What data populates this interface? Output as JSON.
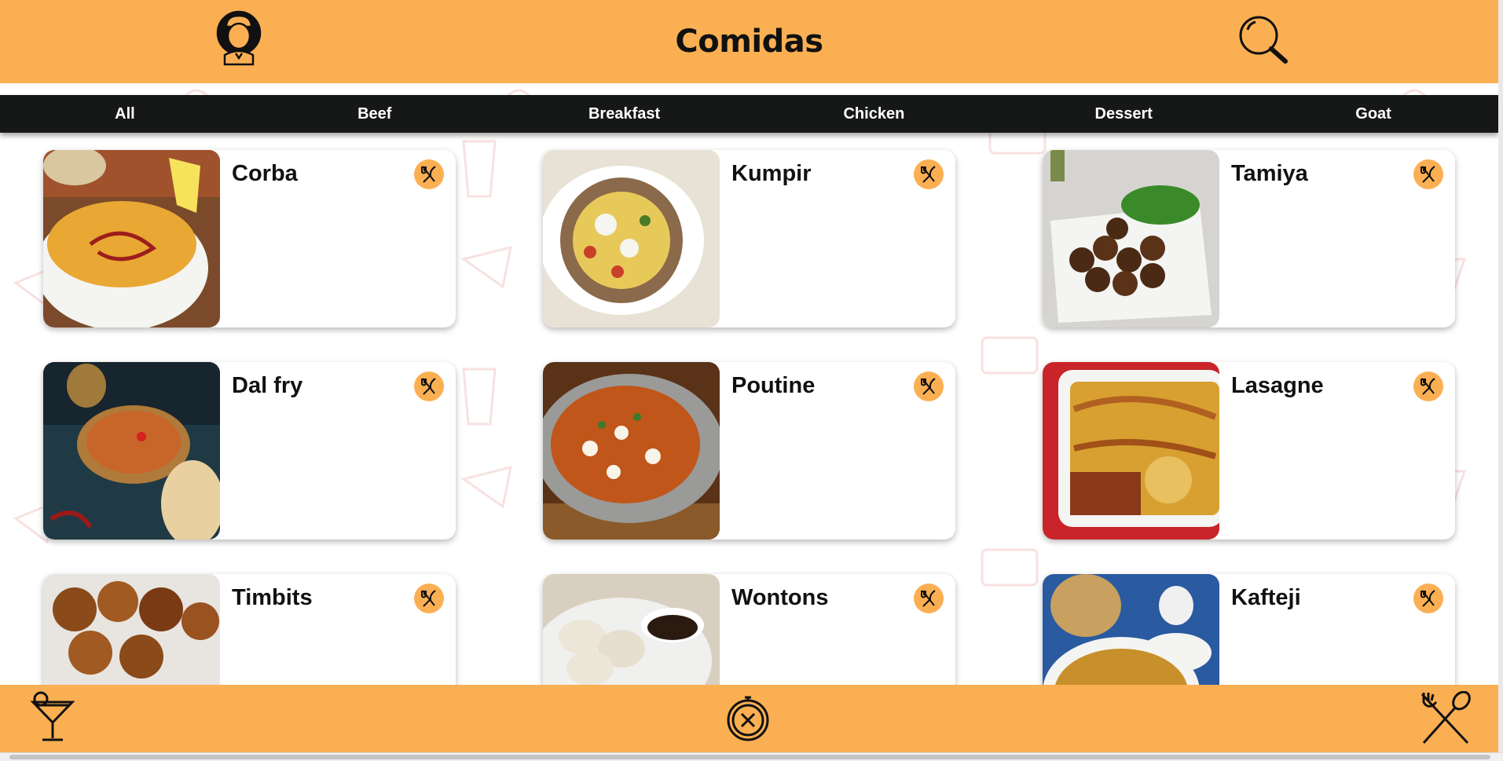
{
  "header": {
    "title": "Comidas",
    "profile_icon": "chef-avatar-icon",
    "search_icon": "search-icon"
  },
  "categories": [
    "All",
    "Beef",
    "Breakfast",
    "Chicken",
    "Dessert",
    "Goat"
  ],
  "recipes": [
    {
      "name": "Corba"
    },
    {
      "name": "Kumpir"
    },
    {
      "name": "Tamiya"
    },
    {
      "name": "Dal fry"
    },
    {
      "name": "Poutine"
    },
    {
      "name": "Lasagne"
    },
    {
      "name": "Timbits"
    },
    {
      "name": "Wontons"
    },
    {
      "name": "Kafteji"
    }
  ],
  "footer": {
    "drinks_icon": "cocktail-icon",
    "explore_icon": "compass-icon",
    "foods_icon": "fork-spoon-icon"
  },
  "colors": {
    "accent": "#fbaf53",
    "category_bar": "#161817",
    "card": "#ffffff"
  }
}
